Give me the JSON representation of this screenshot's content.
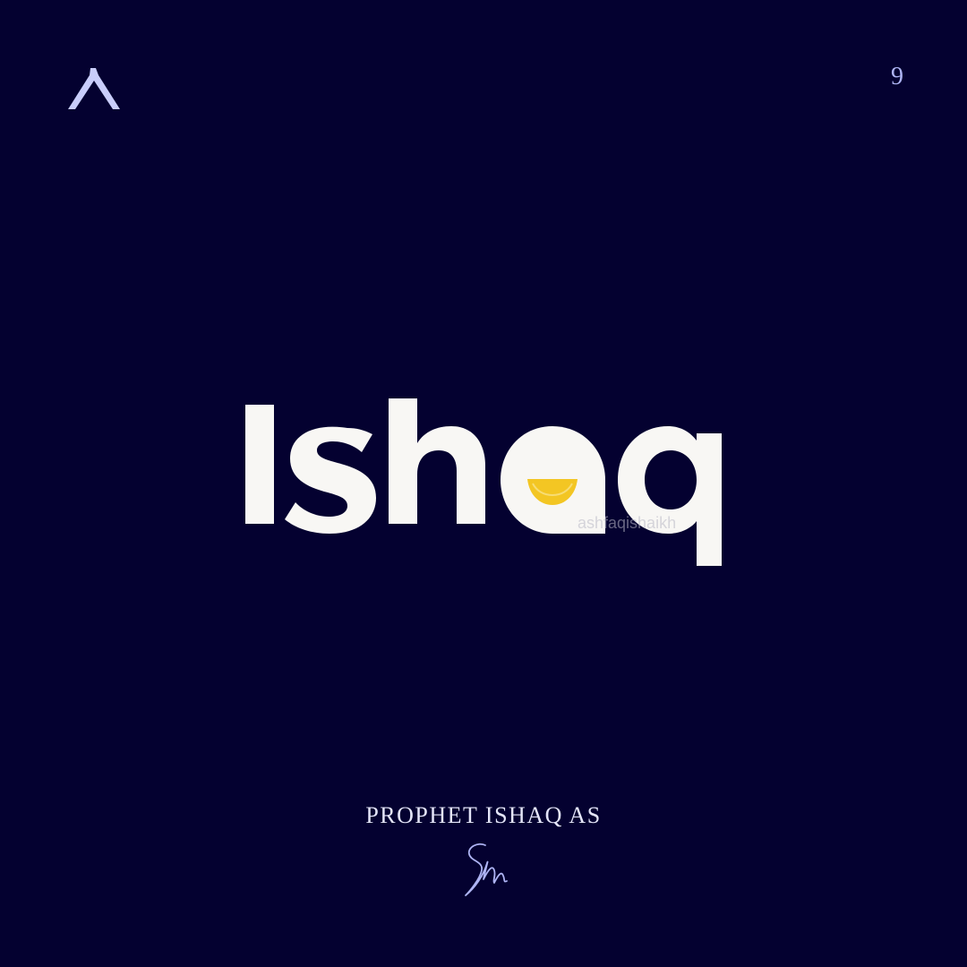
{
  "page_number": "9",
  "wordmark": {
    "title": "Ishaq",
    "watermark": "ashfaqishaikh"
  },
  "caption": "PROPHET ISHAQ AS",
  "icons": {
    "brand_mark": "caret-up-logo-icon",
    "bowl": "yellow-bowl-icon",
    "signature": "handwritten-signature"
  },
  "colors": {
    "background": "#040130",
    "text_primary": "#f8f7f4",
    "accent_yellow": "#f3c623",
    "accent_lavender": "#aeb4f4"
  }
}
